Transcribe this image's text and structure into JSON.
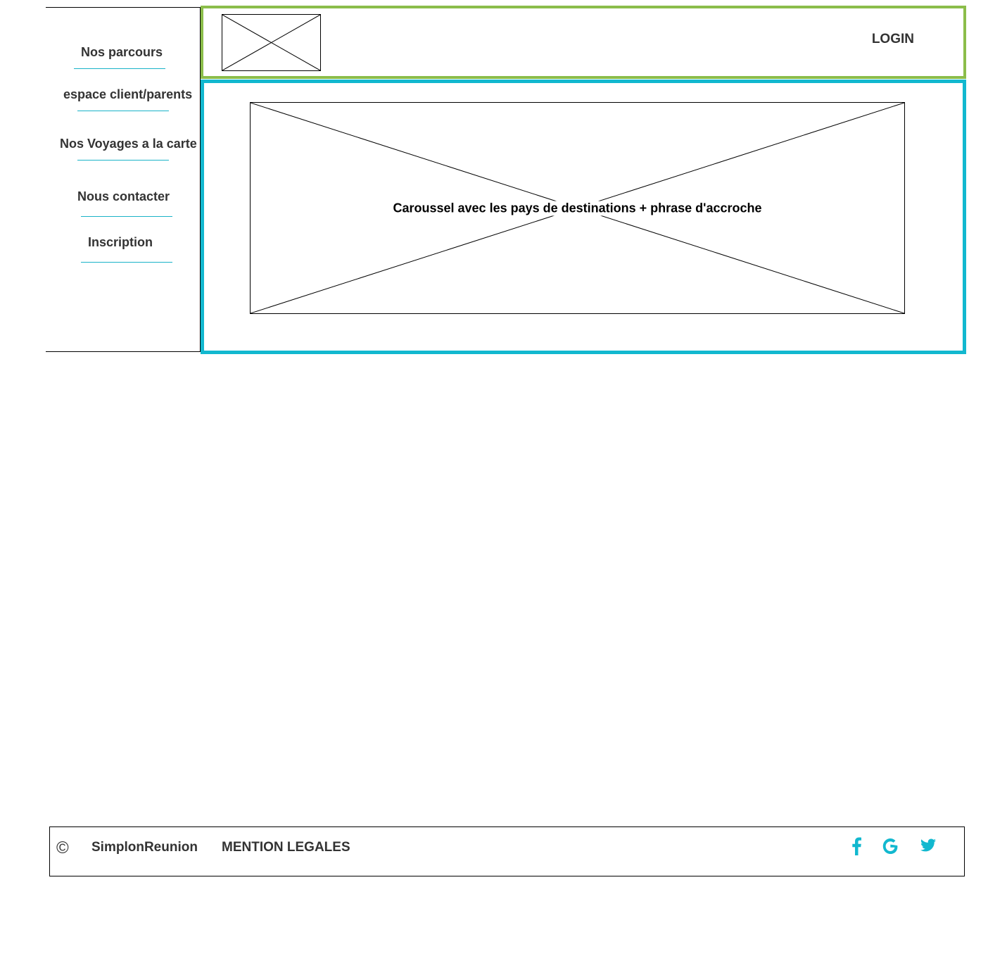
{
  "sidebar": {
    "items": [
      {
        "label": "Nos parcours"
      },
      {
        "label": "espace client/parents"
      },
      {
        "label": "Nos Voyages a la carte"
      },
      {
        "label": "Nous contacter"
      },
      {
        "label": "Inscription"
      }
    ]
  },
  "header": {
    "logo_icon": "image-placeholder-icon",
    "login_label": "LOGIN"
  },
  "main": {
    "carousel_text": "Caroussel avec les pays de destinations  + phrase d'accroche"
  },
  "footer": {
    "copyright_symbol": "©",
    "brand": "SimplonReunion",
    "legal_label": "MENTION LEGALES",
    "social_icons": [
      "facebook-icon",
      "google-icon",
      "twitter-icon"
    ]
  },
  "colors": {
    "header_border": "#8bbd4a",
    "main_border": "#12b8cf",
    "accent": "#1ab3c8"
  }
}
